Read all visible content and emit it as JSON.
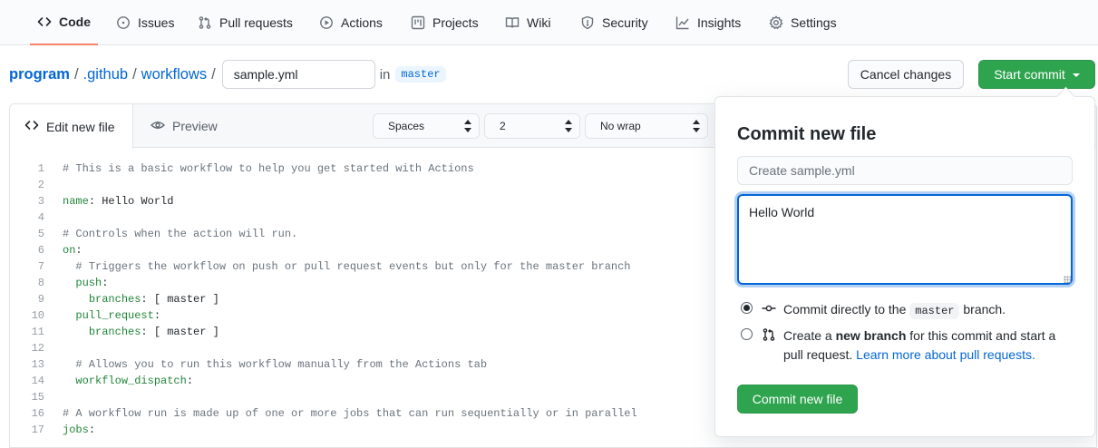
{
  "nav": {
    "tabs": [
      {
        "label": "Code",
        "icon": "code-icon",
        "active": true
      },
      {
        "label": "Issues",
        "icon": "issue-icon"
      },
      {
        "label": "Pull requests",
        "icon": "pull-request-icon"
      },
      {
        "label": "Actions",
        "icon": "play-icon"
      },
      {
        "label": "Projects",
        "icon": "project-icon"
      },
      {
        "label": "Wiki",
        "icon": "book-icon"
      },
      {
        "label": "Security",
        "icon": "shield-icon"
      },
      {
        "label": "Insights",
        "icon": "graph-icon"
      },
      {
        "label": "Settings",
        "icon": "gear-icon"
      }
    ]
  },
  "breadcrumb": {
    "repo": "program",
    "sep": "/",
    "dir1": ".github",
    "dir2": "workflows",
    "filename": "sample.yml",
    "in_label": "in",
    "branch": "master"
  },
  "actions": {
    "cancel": "Cancel changes",
    "start_commit": "Start commit"
  },
  "editor": {
    "tab_edit": "Edit new file",
    "tab_preview": "Preview",
    "indent_mode": "Spaces",
    "indent_size": "2",
    "wrap_mode": "No wrap",
    "lines": [
      {
        "n": "1",
        "text": "# This is a basic workflow to help you get started with Actions"
      },
      {
        "n": "2",
        "text": ""
      },
      {
        "n": "3",
        "text": "name: Hello World"
      },
      {
        "n": "4",
        "text": ""
      },
      {
        "n": "5",
        "text": "# Controls when the action will run."
      },
      {
        "n": "6",
        "text": "on:"
      },
      {
        "n": "7",
        "text": "  # Triggers the workflow on push or pull request events but only for the master branch"
      },
      {
        "n": "8",
        "text": "  push:"
      },
      {
        "n": "9",
        "text": "    branches: [ master ]"
      },
      {
        "n": "10",
        "text": "  pull_request:"
      },
      {
        "n": "11",
        "text": "    branches: [ master ]"
      },
      {
        "n": "12",
        "text": ""
      },
      {
        "n": "13",
        "text": "  # Allows you to run this workflow manually from the Actions tab"
      },
      {
        "n": "14",
        "text": "  workflow_dispatch:"
      },
      {
        "n": "15",
        "text": ""
      },
      {
        "n": "16",
        "text": "# A workflow run is made up of one or more jobs that can run sequentially or in parallel"
      },
      {
        "n": "17",
        "text": "jobs:"
      }
    ]
  },
  "commit": {
    "title": "Commit new file",
    "summary_placeholder": "Create sample.yml",
    "description": "Hello World",
    "option_direct_prefix": "Commit directly to the",
    "option_direct_branch": "master",
    "option_direct_suffix": "branch.",
    "option_new_prefix": "Create a",
    "option_new_bold": "new branch",
    "option_new_suffix": "for this commit and start a pull request.",
    "option_new_link": "Learn more about pull requests.",
    "submit": "Commit new file"
  },
  "colors": {
    "accent": "#0366d6",
    "primary_button": "#2ea44f",
    "active_tab_underline": "#f9826c"
  }
}
